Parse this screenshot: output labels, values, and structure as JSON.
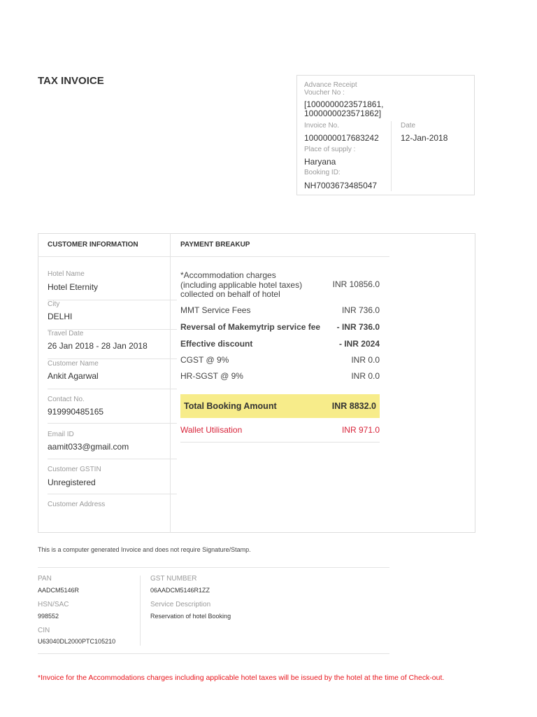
{
  "title": "TAX INVOICE",
  "receipt": {
    "voucher_label": "Advance Receipt Voucher No :",
    "voucher_line1": "[1000000023571861,",
    "voucher_line2": "1000000023571862]",
    "invoice_label": "Invoice No.",
    "invoice_value": "1000000017683242",
    "date_label": "Date",
    "date_value": "12-Jan-2018",
    "supply_label": "Place of supply :",
    "supply_value": "Haryana",
    "booking_label": "Booking ID:",
    "booking_value": "NH7003673485047"
  },
  "customer": {
    "heading": "CUSTOMER INFORMATION",
    "fields": [
      {
        "label": "Hotel Name",
        "value": "Hotel Eternity"
      },
      {
        "label": "City",
        "value": "DELHI"
      },
      {
        "label": "Travel Date",
        "value": "26 Jan 2018 - 28 Jan 2018"
      },
      {
        "label": "Customer Name",
        "value": "Ankit Agarwal"
      },
      {
        "label": "Contact No.",
        "value": "919990485165"
      },
      {
        "label": "Email ID",
        "value": "aamit033@gmail.com"
      },
      {
        "label": "Customer GSTIN",
        "value": "Unregistered"
      },
      {
        "label": "Customer Address",
        "value": ""
      }
    ]
  },
  "payment": {
    "heading": "PAYMENT BREAKUP",
    "accommodation_line1": "*Accommodation charges",
    "accommodation_line2": "(including applicable hotel taxes)",
    "accommodation_line3": "collected on behalf of hotel",
    "accommodation_amount": "INR 10856.0",
    "rows": [
      {
        "label": "MMT Service Fees",
        "amount": "INR 736.0"
      },
      {
        "label": "Reversal of Makemytrip service fee",
        "amount": "- INR 736.0"
      },
      {
        "label": "Effective discount",
        "amount": "- INR 2024"
      },
      {
        "label": "CGST @ 9%",
        "amount": "INR 0.0"
      },
      {
        "label": "HR-SGST @ 9%",
        "amount": "INR 0.0"
      }
    ],
    "total_label": "Total Booking Amount",
    "total_amount": "INR 8832.0",
    "wallet_label": "Wallet Utilisation",
    "wallet_amount": "INR 971.0",
    "highlight_color": "#f7ec8a",
    "accent_red": "#e8141b"
  },
  "note": "This is a computer generated Invoice and does not require Signature/Stamp.",
  "company": {
    "pan_label": "PAN",
    "pan_value": "AADCM5146R",
    "hsn_label": "HSN/SAC",
    "hsn_value": "998552",
    "cin_label": "CIN",
    "cin_value": "U63040DL2000PTC105210",
    "gst_label": "GST NUMBER",
    "gst_value": "06AADCM5146R1ZZ",
    "service_label": "Service Description",
    "service_value": "Reservation of hotel Booking"
  },
  "footer_note": "*Invoice for the Accommodations charges including applicable hotel taxes will be issued by the hotel at the time of Check-out."
}
